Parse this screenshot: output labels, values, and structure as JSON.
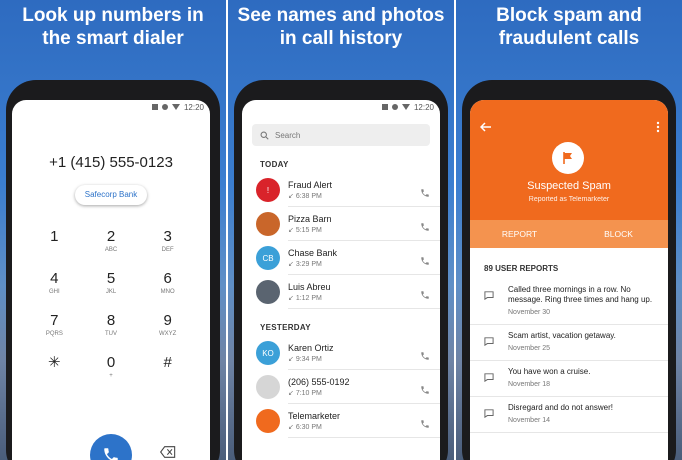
{
  "captions": {
    "dialer": [
      "Look up numbers in",
      "the smart dialer"
    ],
    "history": [
      "See names and photos",
      "in call history"
    ],
    "spam": [
      "Block spam and",
      "fraudulent calls"
    ]
  },
  "status_time": "12:20",
  "dialer": {
    "number": "+1 (415) 555-0123",
    "contact_chip": "Safecorp Bank",
    "keys": [
      {
        "digit": "1",
        "letters": ""
      },
      {
        "digit": "2",
        "letters": "ABC"
      },
      {
        "digit": "3",
        "letters": "DEF"
      },
      {
        "digit": "4",
        "letters": "GHI"
      },
      {
        "digit": "5",
        "letters": "JKL"
      },
      {
        "digit": "6",
        "letters": "MNO"
      },
      {
        "digit": "7",
        "letters": "PQRS"
      },
      {
        "digit": "8",
        "letters": "TUV"
      },
      {
        "digit": "9",
        "letters": "WXYZ"
      },
      {
        "digit": "✳",
        "letters": ""
      },
      {
        "digit": "0",
        "letters": "+"
      },
      {
        "digit": "#",
        "letters": ""
      }
    ]
  },
  "history": {
    "search_placeholder": "Search",
    "sections": [
      {
        "title": "TODAY",
        "rows": [
          {
            "name": "Fraud Alert",
            "time": "6:38 PM",
            "avatar": "!",
            "color": "#d9232a"
          },
          {
            "name": "Pizza Barn",
            "time": "5:15 PM",
            "avatar": "",
            "color": "#c9662a"
          },
          {
            "name": "Chase Bank",
            "time": "3:29 PM",
            "avatar": "CB",
            "color": "#3ba0d8"
          },
          {
            "name": "Luis Abreu",
            "time": "1:12 PM",
            "avatar": "",
            "color": "#5a6470"
          }
        ]
      },
      {
        "title": "YESTERDAY",
        "rows": [
          {
            "name": "Karen Ortiz",
            "time": "9:34 PM",
            "avatar": "KO",
            "color": "#3ba0d8"
          },
          {
            "name": "(206) 555-0192",
            "time": "7:10 PM",
            "avatar": "",
            "color": "#d6d6d6"
          },
          {
            "name": "Telemarketer",
            "time": "6:30 PM",
            "avatar": "",
            "color": "#f06a1e"
          }
        ]
      }
    ]
  },
  "spam": {
    "title": "Suspected Spam",
    "subtitle": "Reported as Telemarketer",
    "report_label": "REPORT",
    "block_label": "BLOCK",
    "reports_header": "89 USER REPORTS",
    "reports": [
      {
        "text": "Called three mornings in a row. No message.  Ring three times and hang up.",
        "date": "November 30"
      },
      {
        "text": "Scam artist, vacation getaway.",
        "date": "November 25"
      },
      {
        "text": "You have won a cruise.",
        "date": "November 18"
      },
      {
        "text": "Disregard and do not answer!",
        "date": "November 14"
      }
    ]
  }
}
